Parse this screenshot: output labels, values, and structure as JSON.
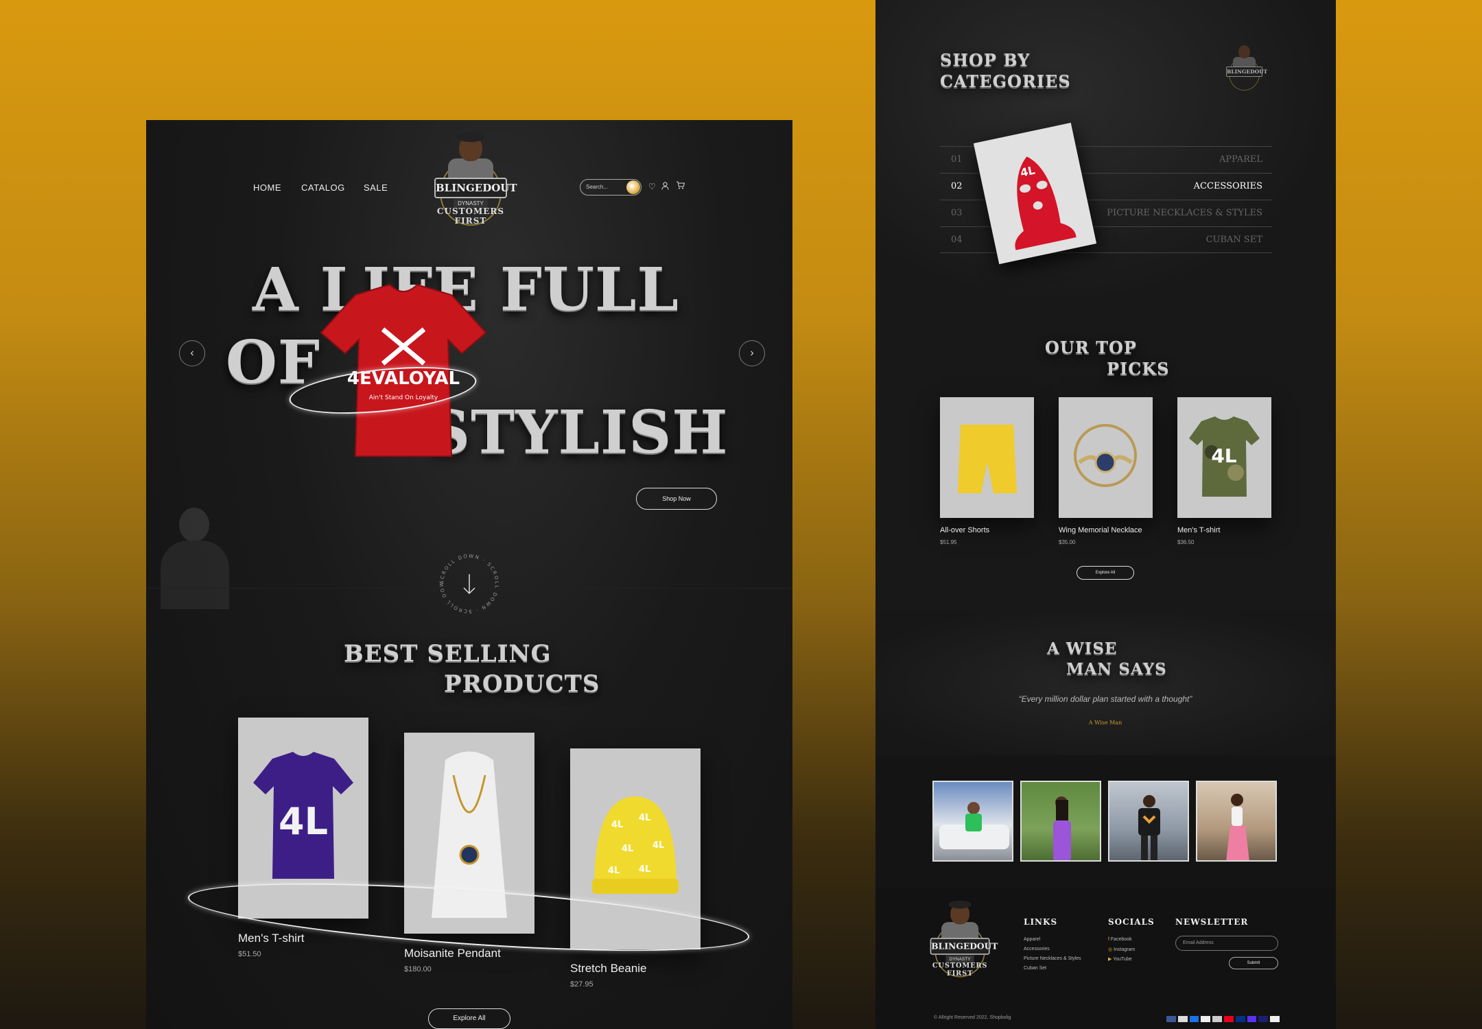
{
  "left_page": {
    "nav": {
      "home": "HOME",
      "catalog": "CATALOG",
      "sale": "SALE"
    },
    "logo": {
      "main": "BLINGEDOUT",
      "sub": "DYNASTY",
      "arc": "CUSTOMERS FIRST"
    },
    "search_placeholder": "Search...",
    "hero": {
      "line1": "A LIFE FULL",
      "line2": "OF",
      "line3": "STYLISH",
      "shirt_text": "4EVALOYAL",
      "shirt_sub": "Ain't Stand On Loyalty",
      "shop_now": "Shop Now"
    },
    "scroll_text": "SCROLL DOWN · SCROLL DOWN · SCROLL DOWN ·",
    "best_selling": {
      "line1": "BEST SELLING",
      "line2": "PRODUCTS"
    },
    "products": [
      {
        "name": "Men's T-shirt",
        "price": "$51.50"
      },
      {
        "name": "Moisanite Pendant",
        "price": "$180.00"
      },
      {
        "name": "Stretch Beanie",
        "price": "$27.95"
      }
    ],
    "explore_all": "Explore All"
  },
  "right_page": {
    "categories_title": {
      "line1": "SHOP BY",
      "line2": "CATEGORIES"
    },
    "categories": [
      {
        "num": "01",
        "label": "APPAREL"
      },
      {
        "num": "02",
        "label": "ACCESSORIES"
      },
      {
        "num": "03",
        "label": "PICTURE NECKLACES & STYLES"
      },
      {
        "num": "04",
        "label": "CUBAN SET"
      }
    ],
    "top_picks_title": {
      "line1": "OUR TOP",
      "line2": "PICKS"
    },
    "top_picks": [
      {
        "name": "All-over Shorts",
        "price": "$51.95"
      },
      {
        "name": "Wing Memorial Necklace",
        "price": "$35.00"
      },
      {
        "name": "Men's T-shirt",
        "price": "$36.50"
      }
    ],
    "explore_all": "Explore All",
    "quote_title": {
      "line1": "A WISE",
      "line2": "MAN SAYS"
    },
    "quote": "“Every million dollar plan started with a thought”",
    "quote_author": "A Wise Man",
    "footer": {
      "links_title": "LINKS",
      "links": [
        "Apparel",
        "Accessories",
        "Picture Necklaces & Styles",
        "Cuban Set"
      ],
      "socials_title": "SOCIALS",
      "socials": [
        "Facebook",
        "Instagram",
        "YouTube"
      ],
      "newsletter_title": "NEWSLETTER",
      "email_placeholder": "Email Address",
      "submit": "Submit",
      "copyright": "© Allright Reserved 2022, Shopbolig"
    }
  },
  "colors": {
    "gold": "#d9990f",
    "accent_red": "#c8161d",
    "quote_gold": "#c99a2e"
  }
}
